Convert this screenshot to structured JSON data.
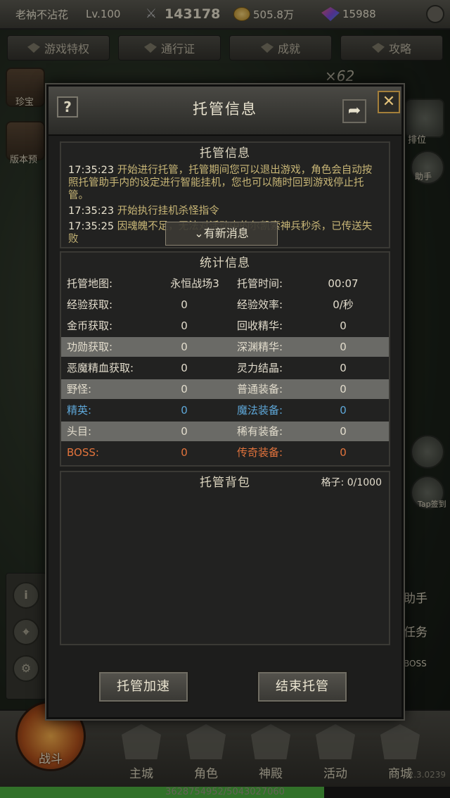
{
  "hud": {
    "player_name": "老衲不沾花",
    "level": "Lv.100",
    "combat_power": "143178",
    "gold": "505.8万",
    "gems": "15988"
  },
  "tabs": [
    "游戏特权",
    "通行证",
    "成就",
    "攻略"
  ],
  "side": {
    "left_top": "珍宝",
    "left_second": "版本预",
    "right_rank": "排位",
    "right_helper": "助手",
    "right_sign": "Tap签到",
    "multiplier": "×62"
  },
  "right_partial": [
    "助手",
    "任务",
    "BOSS"
  ],
  "left_column": [
    "i",
    "⌖",
    "⚙"
  ],
  "bottom_nav": [
    "战斗",
    "主城",
    "角色",
    "神殿",
    "活动",
    "商城"
  ],
  "exp_text": "3628754952/5043027060",
  "exp_ratio": 0.72,
  "version": "2.3.0239",
  "modal": {
    "title": "托管信息",
    "help": "?",
    "close": "✕",
    "log": {
      "title": "托管信息",
      "lines": [
        {
          "time": "17:35:23",
          "text": "开始进行托管，托管期间您可以退出游戏，角色会自动按照托管助手内的设定进行智能挂机，您也可以随时回到游戏停止托管。"
        },
        {
          "time": "17:35:23",
          "text": "开始执行挂机杀怪指令"
        },
        {
          "time": "17:35:25",
          "text": "因魂魄不足，无法对活动中的尔凯索神兵秒杀，已传送失败"
        }
      ],
      "new_msg": "⌄有新消息"
    },
    "stats": {
      "title": "统计信息",
      "rows": [
        {
          "k1": "托管地图:",
          "v1": "永恒战场3",
          "k2": "托管时间:",
          "v2": "00:07",
          "style": "def",
          "shade": false
        },
        {
          "k1": "经验获取:",
          "v1": "0",
          "k2": "经验效率:",
          "v2": "0/秒",
          "style": "def",
          "shade": false
        },
        {
          "k1": "金币获取:",
          "v1": "0",
          "k2": "回收精华:",
          "v2": "0",
          "style": "def",
          "shade": false
        },
        {
          "k1": "功勋获取:",
          "v1": "0",
          "k2": "深渊精华:",
          "v2": "0",
          "style": "def",
          "shade": true
        },
        {
          "k1": "恶魔精血获取:",
          "v1": "0",
          "k2": "灵力结晶:",
          "v2": "0",
          "style": "def",
          "shade": false
        },
        {
          "k1": "野怪:",
          "v1": "0",
          "k2": "普通装备:",
          "v2": "0",
          "style": "def",
          "shade": true
        },
        {
          "k1": "精英:",
          "v1": "0",
          "k2": "魔法装备:",
          "v2": "0",
          "style": "elite",
          "shade": false
        },
        {
          "k1": "头目:",
          "v1": "0",
          "k2": "稀有装备:",
          "v2": "0",
          "style": "head",
          "shade": true
        },
        {
          "k1": "BOSS:",
          "v1": "0",
          "k2": "传奇装备:",
          "v2": "0",
          "style": "boss",
          "shade": false
        }
      ]
    },
    "bag": {
      "title": "托管背包",
      "slots_label": "格子:",
      "slots_value": "0/1000"
    },
    "buttons": {
      "speedup": "托管加速",
      "end": "结束托管"
    }
  },
  "colors": {
    "elite": "#5ea7d8",
    "boss": "#e2733c",
    "log_text": "#c9b777",
    "close_border": "#a47f3a"
  }
}
